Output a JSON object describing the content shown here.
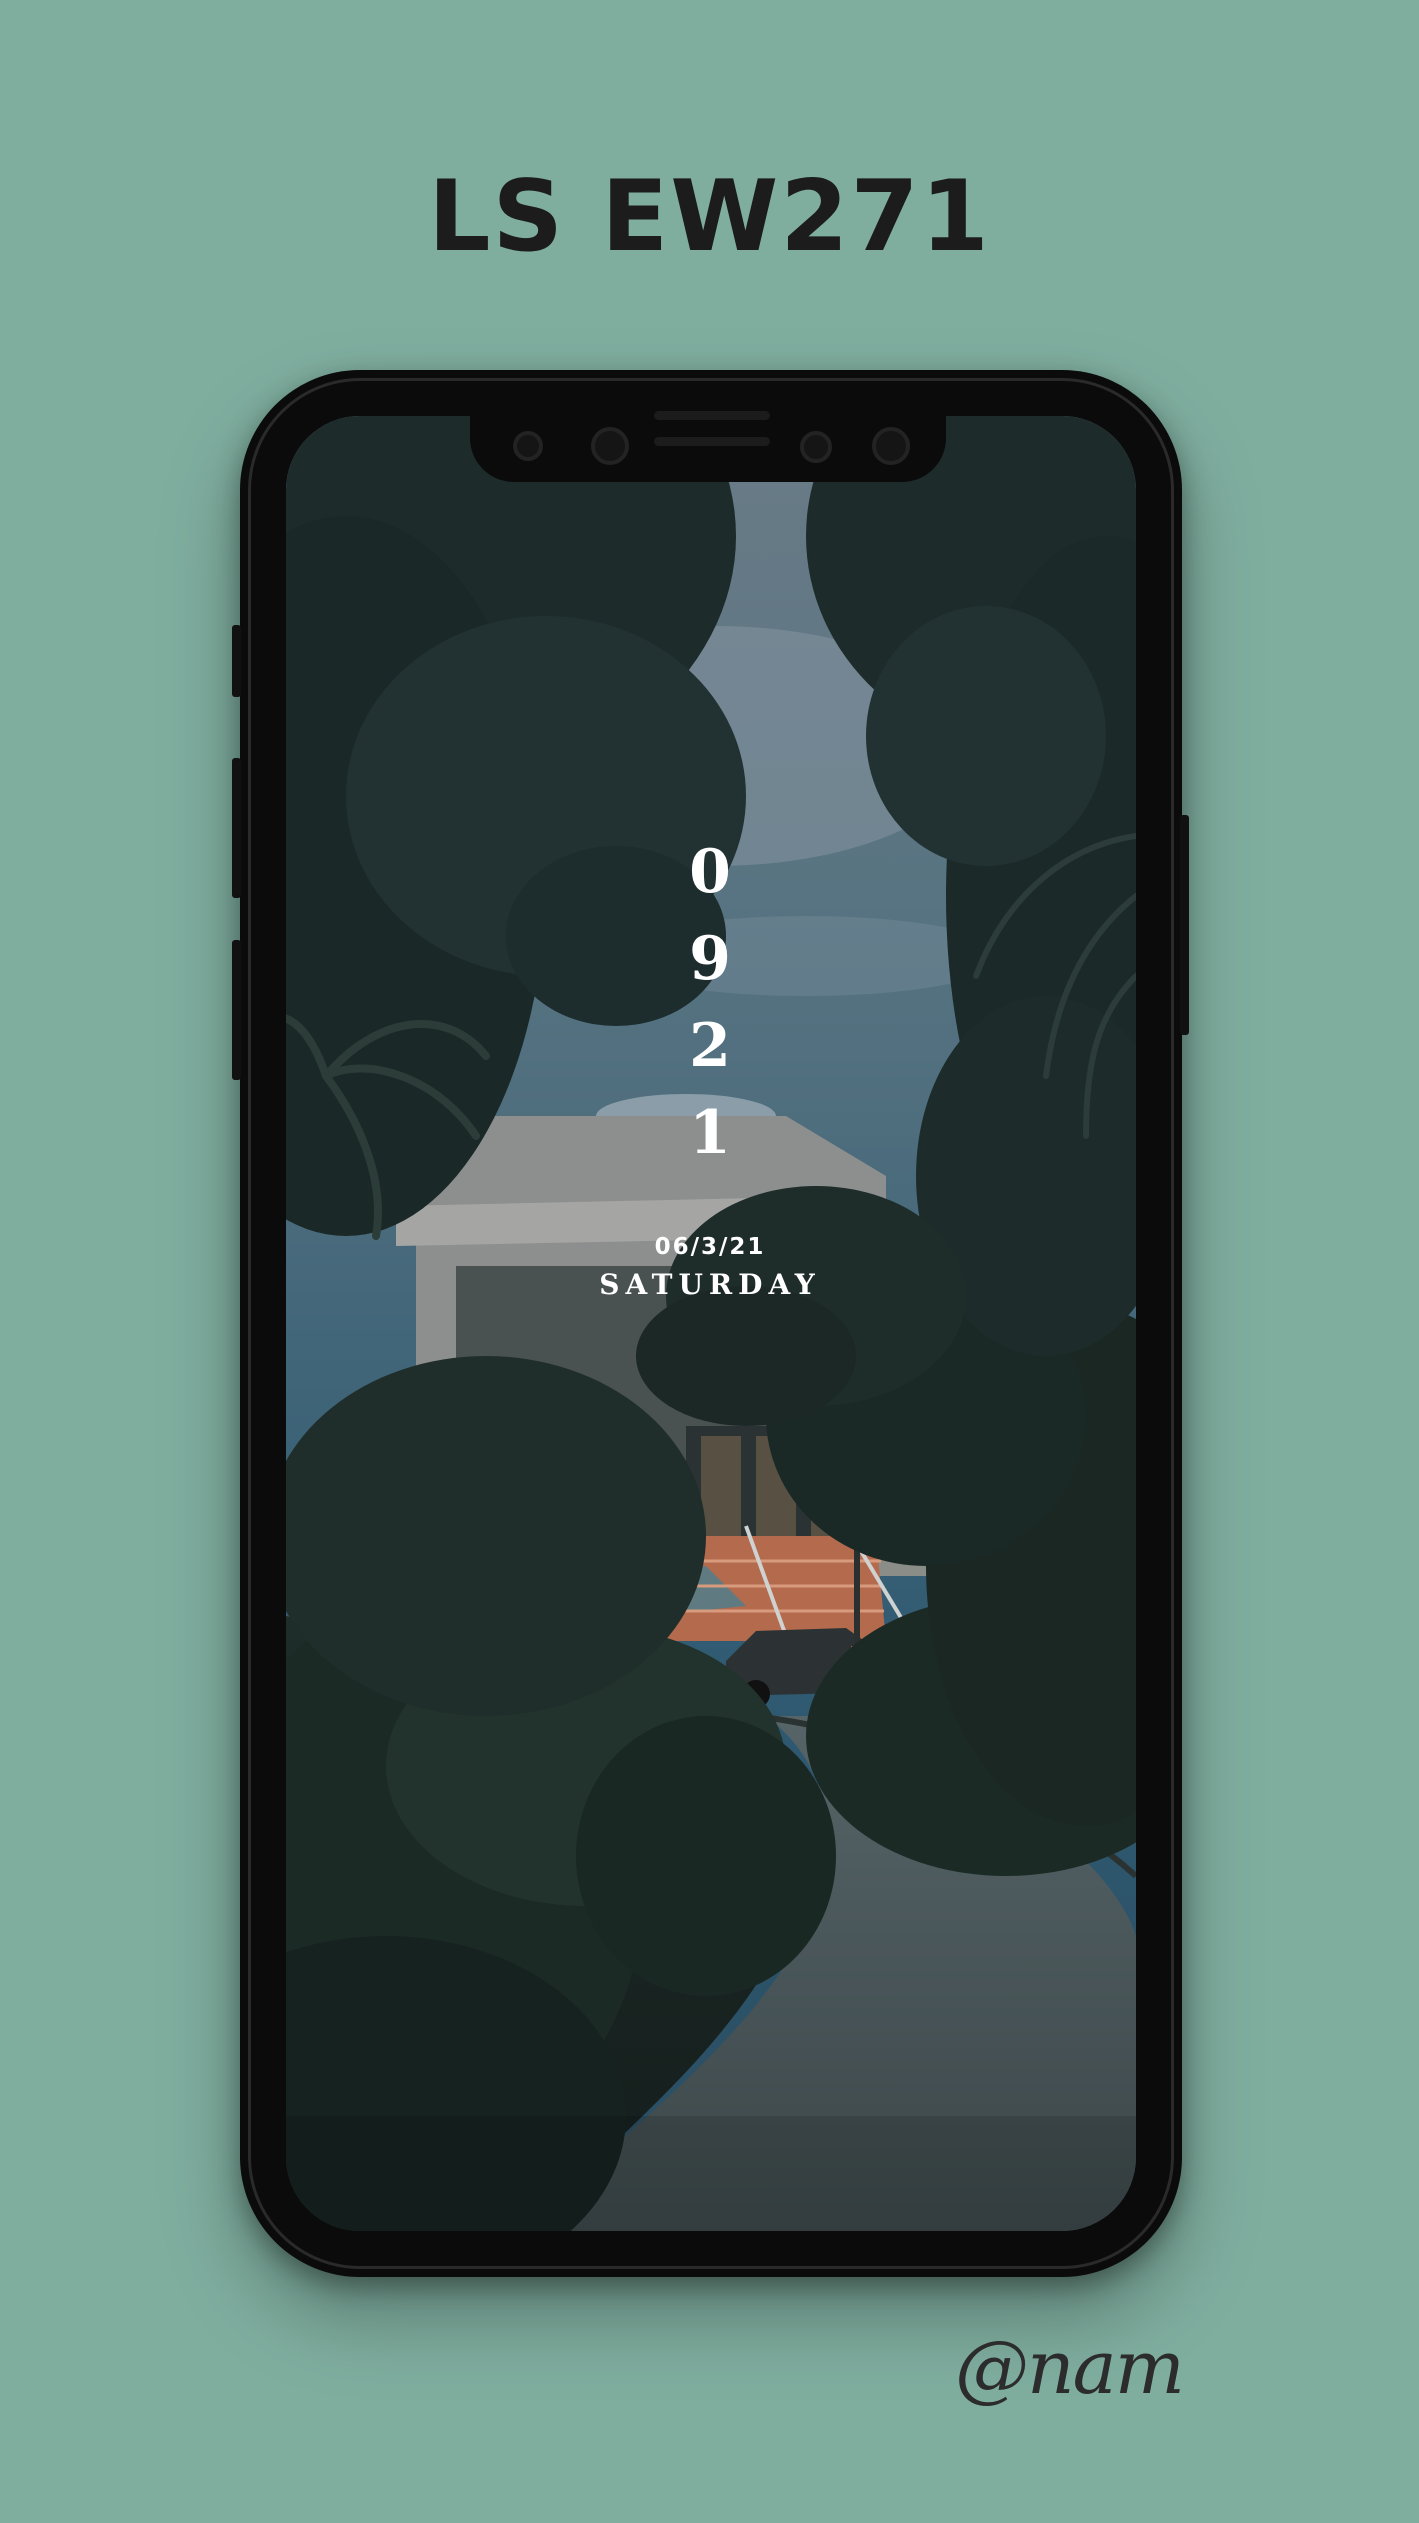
{
  "title": "LS EW271",
  "lockscreen": {
    "time_digits": [
      "0",
      "9",
      "2",
      "1"
    ],
    "date": "06/3/21",
    "day": "SATURDAY"
  },
  "signature": "@nam",
  "colors": {
    "background": "#7fae9f",
    "phone_body": "#0b0b0b",
    "title_text": "#1c1c1c",
    "clock_text": "#ffffff"
  }
}
